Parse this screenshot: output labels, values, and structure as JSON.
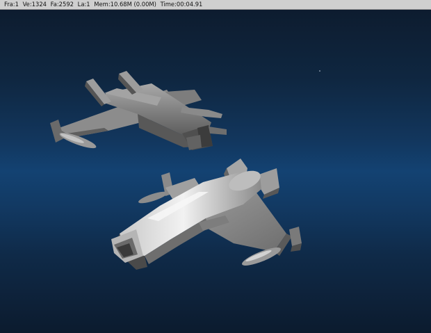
{
  "status": {
    "frame": "Fra:1",
    "vertices": "Ve:1324",
    "faces": "Fa:2592",
    "lamps": "La:1",
    "memory": "Mem:10.68M (0.00M)",
    "time": "Time:00:04.91"
  },
  "render": {
    "background_top": "#0d1c2f",
    "background_mid": "#134272",
    "background_bottom": "#0c1b2e",
    "model_color": "#8e8e8e"
  }
}
